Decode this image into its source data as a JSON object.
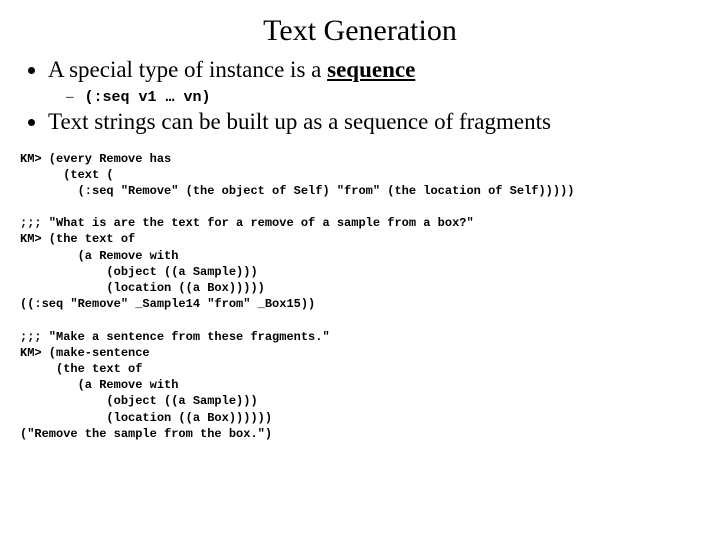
{
  "title": "Text Generation",
  "bullets": {
    "b1_pre": "A special type of instance is a ",
    "b1_seq": "sequence",
    "sub_code": "(:seq v1 … vn)",
    "b2": "Text strings can be built up as a sequence of fragments"
  },
  "code": "KM> (every Remove has\n      (text (\n        (:seq \"Remove\" (the object of Self) \"from\" (the location of Self)))))\n\n;;; \"What is are the text for a remove of a sample from a box?\"\nKM> (the text of\n        (a Remove with\n            (object ((a Sample)))\n            (location ((a Box)))))\n((:seq \"Remove\" _Sample14 \"from\" _Box15))\n\n;;; \"Make a sentence from these fragments.\"\nKM> (make-sentence\n     (the text of\n        (a Remove with\n            (object ((a Sample)))\n            (location ((a Box))))))\n(\"Remove the sample from the box.\")"
}
